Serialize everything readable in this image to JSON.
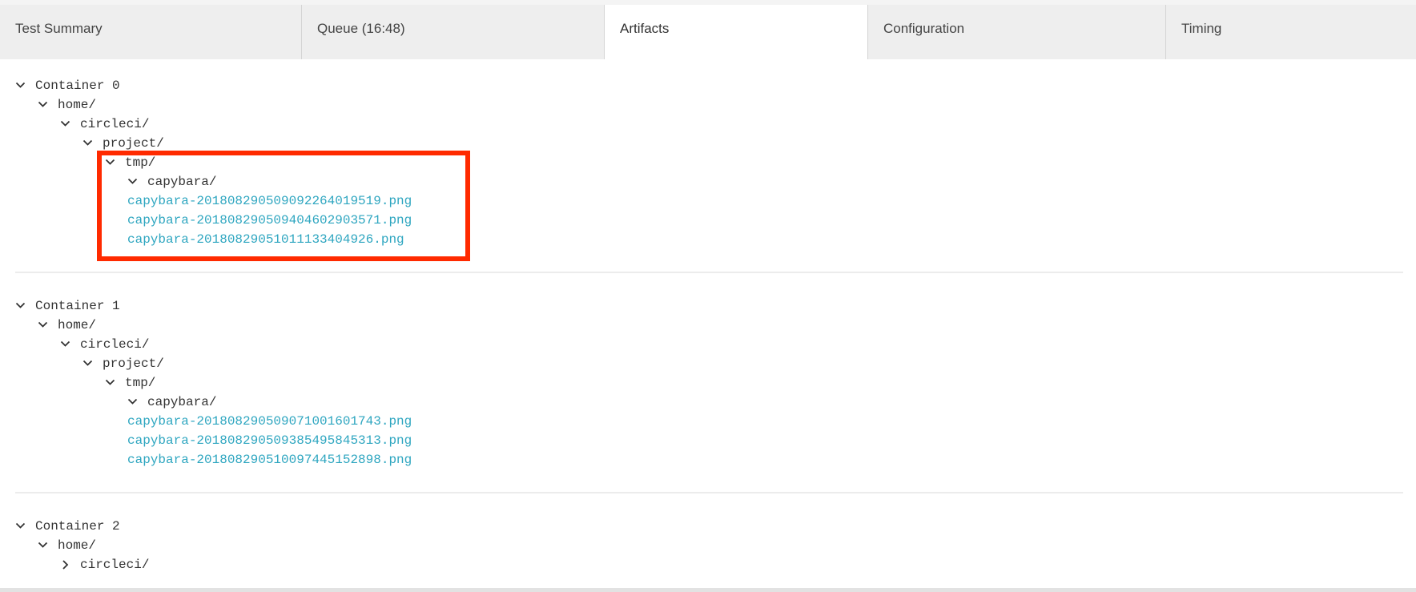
{
  "tabs": [
    {
      "label": "Test Summary",
      "active": false
    },
    {
      "label": "Queue (16:48)",
      "active": false
    },
    {
      "label": "Artifacts",
      "active": true
    },
    {
      "label": "Configuration",
      "active": false
    },
    {
      "label": "Timing",
      "active": false
    }
  ],
  "colors": {
    "link": "#2ea6c0",
    "highlight_box": "#ff2a00",
    "tab_bg": "#eeeeee"
  },
  "containers": [
    {
      "rows": [
        {
          "depth": 0,
          "label": "Container 0",
          "kind": "expanded"
        },
        {
          "depth": 1,
          "label": "home/",
          "kind": "expanded"
        },
        {
          "depth": 2,
          "label": "circleci/",
          "kind": "expanded"
        },
        {
          "depth": 3,
          "label": "project/",
          "kind": "expanded"
        },
        {
          "depth": 4,
          "label": "tmp/",
          "kind": "expanded"
        },
        {
          "depth": 5,
          "label": "capybara/",
          "kind": "expanded"
        },
        {
          "depth": 6,
          "label": "capybara-201808290509092264019519.png",
          "kind": "file"
        },
        {
          "depth": 6,
          "label": "capybara-201808290509404602903571.png",
          "kind": "file"
        },
        {
          "depth": 6,
          "label": "capybara-20180829051011133404926.png",
          "kind": "file"
        }
      ]
    },
    {
      "rows": [
        {
          "depth": 0,
          "label": "Container 1",
          "kind": "expanded"
        },
        {
          "depth": 1,
          "label": "home/",
          "kind": "expanded"
        },
        {
          "depth": 2,
          "label": "circleci/",
          "kind": "expanded"
        },
        {
          "depth": 3,
          "label": "project/",
          "kind": "expanded"
        },
        {
          "depth": 4,
          "label": "tmp/",
          "kind": "expanded"
        },
        {
          "depth": 5,
          "label": "capybara/",
          "kind": "expanded"
        },
        {
          "depth": 6,
          "label": "capybara-201808290509071001601743.png",
          "kind": "file"
        },
        {
          "depth": 6,
          "label": "capybara-201808290509385495845313.png",
          "kind": "file"
        },
        {
          "depth": 6,
          "label": "capybara-201808290510097445152898.png",
          "kind": "file"
        }
      ]
    },
    {
      "rows": [
        {
          "depth": 0,
          "label": "Container 2",
          "kind": "expanded"
        },
        {
          "depth": 1,
          "label": "home/",
          "kind": "expanded"
        },
        {
          "depth": 2,
          "label": "circleci/",
          "kind": "collapsed"
        }
      ]
    }
  ]
}
